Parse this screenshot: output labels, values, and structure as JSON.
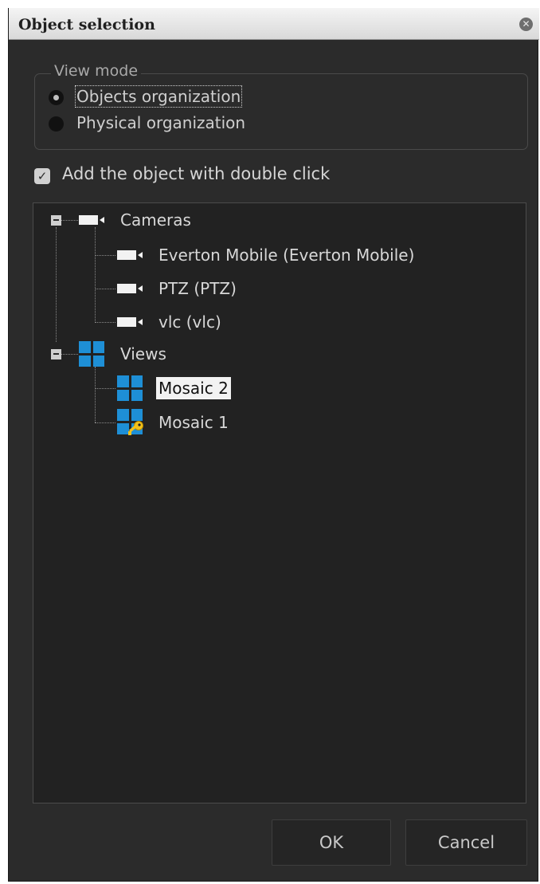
{
  "dialog": {
    "title": "Object selection",
    "close_icon": "close-icon"
  },
  "view_mode": {
    "legend": "View mode",
    "options": [
      {
        "label": "Objects organization",
        "checked": true
      },
      {
        "label": "Physical organization",
        "checked": false
      }
    ]
  },
  "add_on_double_click": {
    "label": "Add the object with double click",
    "checked": true
  },
  "tree": {
    "cameras": {
      "label": "Cameras",
      "icon": "camera-icon",
      "expanded": true,
      "children": [
        {
          "label": "Everton Mobile (Everton Mobile)",
          "icon": "camera-icon"
        },
        {
          "label": "PTZ (PTZ)",
          "icon": "camera-icon"
        },
        {
          "label": "vlc (vlc)",
          "icon": "camera-icon"
        }
      ]
    },
    "views": {
      "label": "Views",
      "icon": "mosaic-icon",
      "expanded": true,
      "children": [
        {
          "label": "Mosaic 2",
          "icon": "mosaic-icon",
          "selected": true
        },
        {
          "label": "Mosaic 1",
          "icon": "mosaic-key-icon",
          "selected": false
        }
      ]
    }
  },
  "buttons": {
    "ok": "OK",
    "cancel": "Cancel"
  },
  "colors": {
    "window_bg": "#2b2b2b",
    "tree_bg": "#222222",
    "accent_blue": "#1e8fd6",
    "key_yellow": "#f2c21b"
  }
}
